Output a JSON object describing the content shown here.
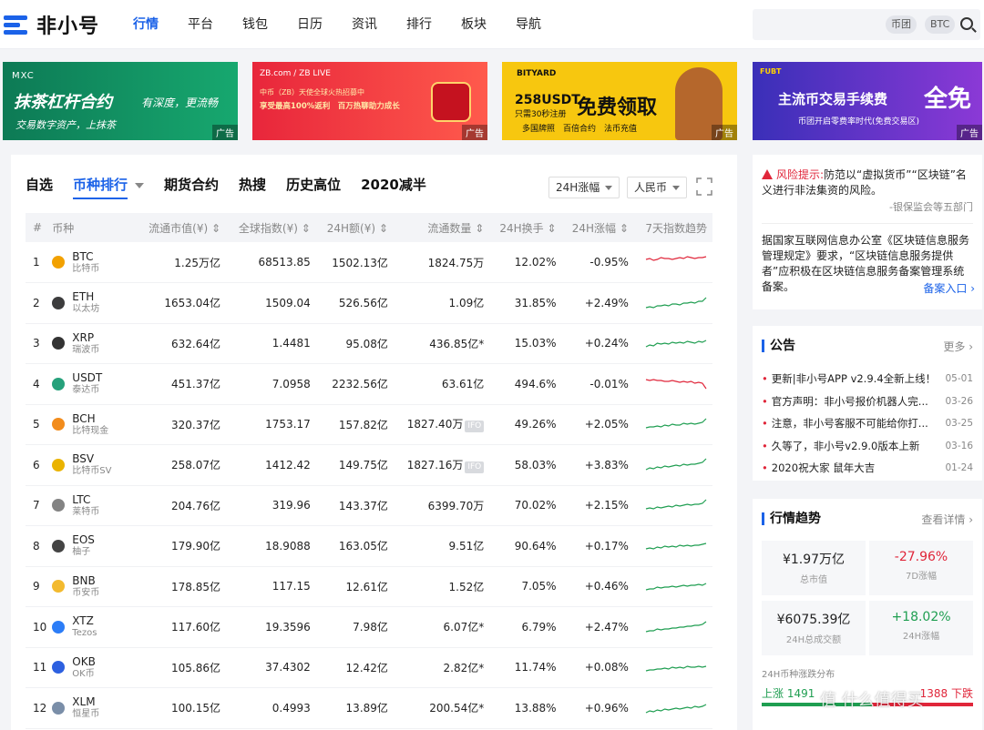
{
  "header": {
    "logo_text": "非小号",
    "nav": [
      "行情",
      "平台",
      "钱包",
      "日历",
      "资讯",
      "排行",
      "板块",
      "导航"
    ],
    "search_tags": [
      "币团",
      "BTC"
    ]
  },
  "banners": [
    {
      "brand": "MXC",
      "title": "抹茶杠杆合约",
      "slogan": "有深度，更流畅",
      "sub": "交易数字资产，上抹茶",
      "ad": "广告"
    },
    {
      "brand": "ZB.com / ZB LIVE",
      "line1": "中币（ZB）天使全球火热招募中",
      "line2": "享受最高100%返利　百万热聊助力成长",
      "ad": "广告"
    },
    {
      "brand": "BITYARD",
      "title": "258USDT",
      "sub": "只需30秒注册",
      "big": "免费领取",
      "row": "多国牌照　百倍合约　法币充值",
      "ad": "广告"
    },
    {
      "brand": "FUBT",
      "title": "主流币交易手续费",
      "big": "全免",
      "sub": "币团开启零费率时代(免费交易区)",
      "ad": "广告"
    }
  ],
  "main": {
    "tabs": [
      "自选",
      "币种排行",
      "期货合约",
      "热搜",
      "历史高位",
      "2020减半"
    ],
    "active_tab": 1,
    "filter_change": "24H涨幅",
    "filter_currency": "人民币",
    "columns": [
      "#",
      "币种",
      "流通市值(¥)",
      "全球指数(¥)",
      "24H额(¥)",
      "流通数量",
      "24H换手",
      "24H涨幅",
      "7天指数趋势"
    ],
    "rows": [
      {
        "rank": "1",
        "sym": "BTC",
        "cn": "比特币",
        "mcap": "1.25万亿",
        "idx": "68513.85",
        "vol": "1502.13亿",
        "supply": "1824.75万",
        "ifo": "",
        "turn": "12.02%",
        "chg": "-0.95%",
        "dir": "down",
        "icon": "#f2a100",
        "spark": [
          6,
          5,
          7,
          6,
          4,
          5,
          5,
          6,
          5,
          4,
          5,
          3,
          4,
          5,
          4,
          4,
          3
        ]
      },
      {
        "rank": "2",
        "sym": "ETH",
        "cn": "以太坊",
        "mcap": "1653.04亿",
        "idx": "1509.04",
        "vol": "526.56亿",
        "supply": "1.09亿",
        "ifo": "",
        "turn": "31.85%",
        "chg": "+2.49%",
        "dir": "up",
        "icon": "#3c3c3d",
        "spark": [
          14,
          13,
          14,
          12,
          12,
          11,
          12,
          10,
          10,
          11,
          9,
          9,
          8,
          9,
          7,
          7,
          3
        ]
      },
      {
        "rank": "3",
        "sym": "XRP",
        "cn": "瑞波币",
        "mcap": "632.64亿",
        "idx": "1.4481",
        "vol": "95.08亿",
        "supply": "436.85亿*",
        "ifo": "",
        "turn": "15.03%",
        "chg": "+0.24%",
        "dir": "up",
        "icon": "#333333",
        "spark": [
          13,
          11,
          12,
          9,
          10,
          9,
          10,
          8,
          9,
          8,
          9,
          7,
          8,
          9,
          7,
          8,
          6
        ]
      },
      {
        "rank": "4",
        "sym": "USDT",
        "cn": "泰达币",
        "mcap": "451.37亿",
        "idx": "7.0958",
        "vol": "2232.56亿",
        "supply": "63.61亿",
        "ifo": "",
        "turn": "494.6%",
        "chg": "-0.01%",
        "dir": "down",
        "icon": "#26a17b",
        "spark": [
          4,
          5,
          4,
          5,
          5,
          6,
          6,
          5,
          6,
          7,
          6,
          7,
          6,
          8,
          7,
          8,
          14
        ]
      },
      {
        "rank": "5",
        "sym": "BCH",
        "cn": "比特现金",
        "mcap": "320.37亿",
        "idx": "1753.17",
        "vol": "157.82亿",
        "supply": "1827.40万",
        "ifo": "IFO",
        "turn": "49.26%",
        "chg": "+2.05%",
        "dir": "up",
        "icon": "#f28c1c",
        "spark": [
          13,
          12,
          12,
          11,
          12,
          10,
          11,
          9,
          10,
          10,
          8,
          9,
          8,
          9,
          8,
          7,
          3
        ]
      },
      {
        "rank": "6",
        "sym": "BSV",
        "cn": "比特币SV",
        "mcap": "258.07亿",
        "idx": "1412.42",
        "vol": "149.75亿",
        "supply": "1827.16万",
        "ifo": "IFO",
        "turn": "58.03%",
        "chg": "+3.83%",
        "dir": "up",
        "icon": "#eab300",
        "spark": [
          14,
          12,
          13,
          11,
          12,
          10,
          11,
          10,
          9,
          10,
          8,
          9,
          8,
          8,
          7,
          6,
          2
        ]
      },
      {
        "rank": "7",
        "sym": "LTC",
        "cn": "莱特币",
        "mcap": "204.76亿",
        "idx": "319.96",
        "vol": "143.37亿",
        "supply": "6399.70万",
        "ifo": "",
        "turn": "70.02%",
        "chg": "+2.15%",
        "dir": "up",
        "icon": "#838383",
        "spark": [
          13,
          12,
          13,
          11,
          12,
          11,
          10,
          11,
          9,
          10,
          9,
          8,
          9,
          8,
          8,
          7,
          3
        ]
      },
      {
        "rank": "8",
        "sym": "EOS",
        "cn": "柚子",
        "mcap": "179.90亿",
        "idx": "18.9088",
        "vol": "163.05亿",
        "supply": "9.51亿",
        "ifo": "",
        "turn": "90.64%",
        "chg": "+0.17%",
        "dir": "up",
        "icon": "#444444",
        "spark": [
          12,
          11,
          12,
          10,
          11,
          9,
          10,
          9,
          10,
          8,
          9,
          8,
          9,
          8,
          8,
          7,
          6
        ]
      },
      {
        "rank": "9",
        "sym": "BNB",
        "cn": "币安币",
        "mcap": "178.85亿",
        "idx": "117.15",
        "vol": "12.61亿",
        "supply": "1.52亿",
        "ifo": "",
        "turn": "7.05%",
        "chg": "+0.46%",
        "dir": "up",
        "icon": "#f3ba2f",
        "spark": [
          13,
          12,
          12,
          10,
          11,
          10,
          10,
          9,
          10,
          9,
          8,
          9,
          8,
          8,
          7,
          8,
          6
        ]
      },
      {
        "rank": "10",
        "sym": "XTZ",
        "cn": "Tezos",
        "mcap": "117.60亿",
        "idx": "19.3596",
        "vol": "7.98亿",
        "supply": "6.07亿*",
        "ifo": "",
        "turn": "6.79%",
        "chg": "+2.47%",
        "dir": "up",
        "icon": "#2c7df7",
        "spark": [
          14,
          13,
          13,
          11,
          12,
          11,
          11,
          10,
          10,
          9,
          9,
          8,
          8,
          7,
          7,
          6,
          3
        ]
      },
      {
        "rank": "11",
        "sym": "OKB",
        "cn": "OK币",
        "mcap": "105.86亿",
        "idx": "37.4302",
        "vol": "12.42亿",
        "supply": "2.82亿*",
        "ifo": "",
        "turn": "11.74%",
        "chg": "+0.08%",
        "dir": "up",
        "icon": "#2d60e0",
        "spark": [
          13,
          12,
          12,
          11,
          11,
          10,
          11,
          9,
          10,
          9,
          10,
          8,
          9,
          9,
          8,
          9,
          8
        ]
      },
      {
        "rank": "12",
        "sym": "XLM",
        "cn": "恒星币",
        "mcap": "100.15亿",
        "idx": "0.4993",
        "vol": "13.89亿",
        "supply": "200.54亿*",
        "ifo": "",
        "turn": "13.88%",
        "chg": "+0.96%",
        "dir": "up",
        "icon": "#7a8ea8",
        "spark": [
          14,
          12,
          13,
          11,
          12,
          10,
          11,
          10,
          9,
          10,
          9,
          8,
          9,
          7,
          8,
          7,
          5
        ]
      }
    ]
  },
  "risk": {
    "label": "风险提示:",
    "text1": "防范以“虚拟货币”“区块链”名义进行非法集资的风险。",
    "source": "-银保监会等五部门",
    "text2": "据国家互联网信息办公室《区块链信息服务管理规定》要求，“区块链信息服务提供者”应积极在区块链信息服务备案管理系统备案。",
    "link": "备案入口 ›"
  },
  "notice": {
    "title": "公告",
    "more": "更多 ›",
    "items": [
      {
        "t": "更新|非小号APP v2.9.4全新上线！",
        "d": "05-01"
      },
      {
        "t": "官方声明：非小号报价机器人完...",
        "d": "03-26"
      },
      {
        "t": "注意，非小号客服不可能给你打...",
        "d": "03-25"
      },
      {
        "t": "久等了，非小号v2.9.0版本上新",
        "d": "03-16"
      },
      {
        "t": "2020祝大家 鼠年大吉",
        "d": "01-24"
      }
    ]
  },
  "trend": {
    "title": "行情趋势",
    "more": "查看详情 ›",
    "stats": [
      {
        "v": "¥1.97万亿",
        "l": "总市值",
        "dir": ""
      },
      {
        "v": "-27.96%",
        "l": "7D涨幅",
        "dir": "down"
      },
      {
        "v": "¥6075.39亿",
        "l": "24H总成交额",
        "dir": ""
      },
      {
        "v": "+18.02%",
        "l": "24H涨幅",
        "dir": "up"
      }
    ],
    "dist_title": "24H币种涨跌分布",
    "up_label": "上涨 1491",
    "down_label": "1388 下跌"
  },
  "watermark": "值 什么值得买",
  "colors": {
    "accent": "#1b62e8",
    "up": "#1f9e51",
    "down": "#e0263a"
  }
}
